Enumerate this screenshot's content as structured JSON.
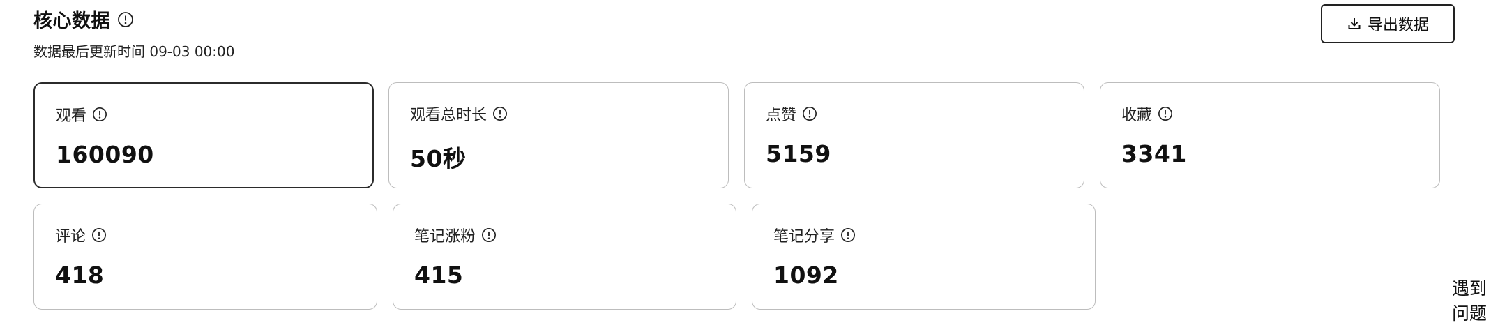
{
  "header": {
    "title": "核心数据",
    "subtitle": "数据最后更新时间 09-03 00:00",
    "export_label": "导出数据"
  },
  "cards": [
    {
      "label": "观看",
      "value": "160090",
      "active": true
    },
    {
      "label": "观看总时长",
      "value": "50秒"
    },
    {
      "label": "点赞",
      "value": "5159"
    },
    {
      "label": "收藏",
      "value": "3341"
    },
    {
      "label": "评论",
      "value": "418"
    },
    {
      "label": "笔记涨粉",
      "value": "415"
    },
    {
      "label": "笔记分享",
      "value": "1092"
    }
  ],
  "help": {
    "line1": "遇到",
    "line2": "问题"
  },
  "icons": {
    "info": "info-circle-icon",
    "download": "download-icon"
  }
}
